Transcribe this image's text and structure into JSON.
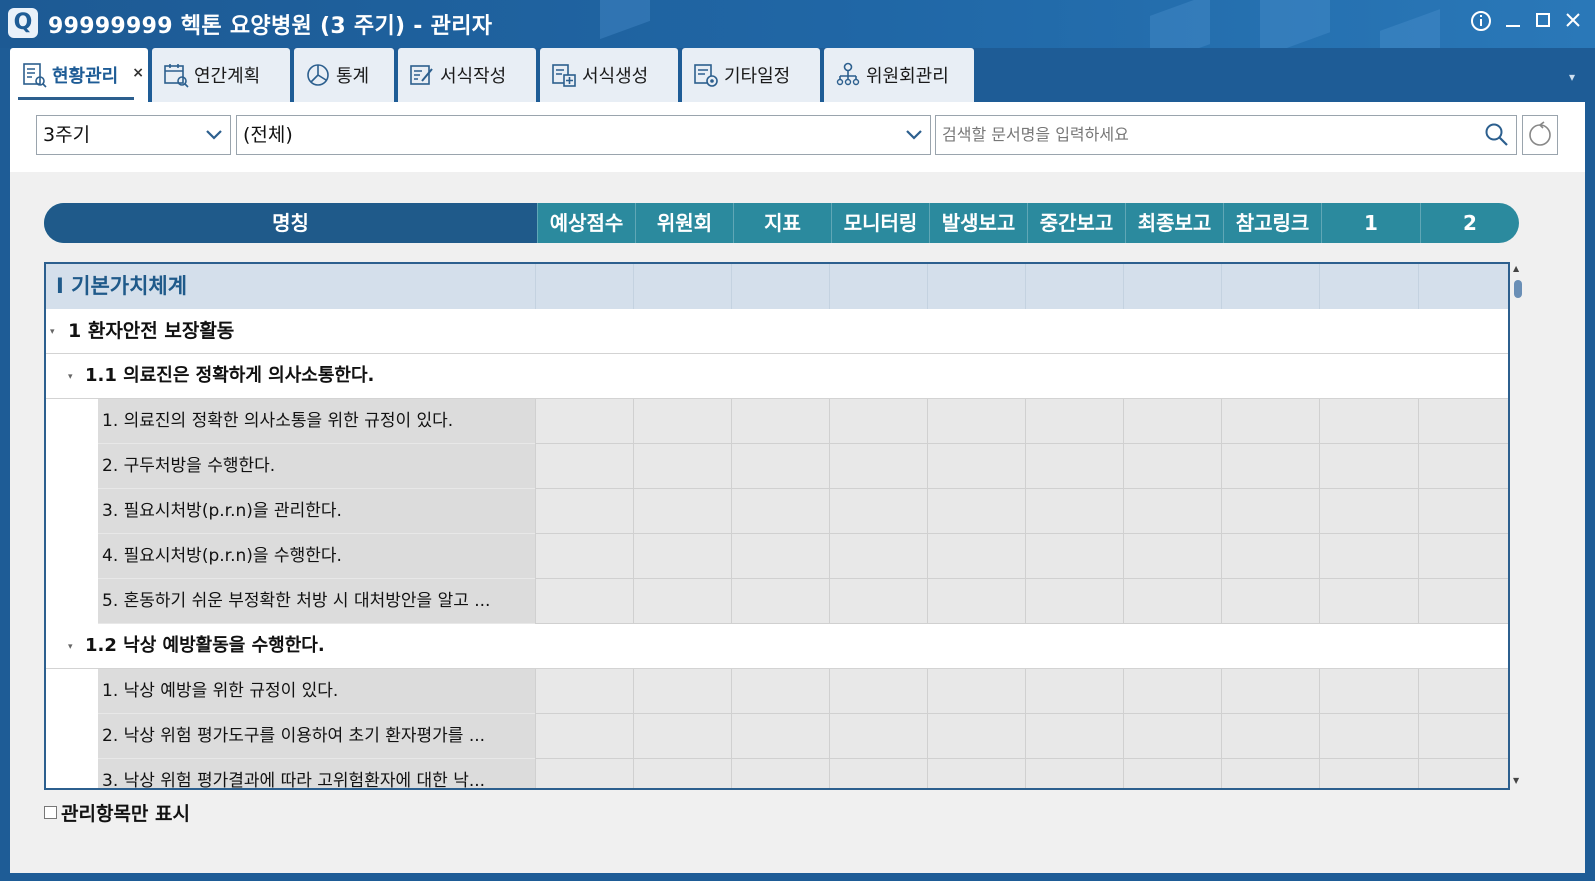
{
  "window": {
    "title": "99999999  헥톤 요양병원 (3 주기) - 관리자",
    "logo": "Q"
  },
  "tabs": [
    {
      "label": "현황관리",
      "icon": "checklist-search-icon",
      "active": true
    },
    {
      "label": "연간계획",
      "icon": "calendar-search-icon"
    },
    {
      "label": "통계",
      "icon": "pie-chart-icon"
    },
    {
      "label": "서식작성",
      "icon": "form-edit-icon"
    },
    {
      "label": "서식생성",
      "icon": "form-add-icon"
    },
    {
      "label": "기타일정",
      "icon": "schedule-gear-icon"
    },
    {
      "label": "위원회관리",
      "icon": "org-chart-icon"
    }
  ],
  "filters": {
    "cycle": "3주기",
    "category": "(전체)",
    "search_placeholder": "검색할 문서명을 입력하세요"
  },
  "columns": {
    "name": "명칭",
    "others": [
      "예상점수",
      "위원회",
      "지표",
      "모니터링",
      "발생보고",
      "중간보고",
      "최종보고",
      "참고링크",
      "1",
      "2"
    ]
  },
  "rows": [
    {
      "type": "section",
      "label": "Ⅰ 기본가치체계"
    },
    {
      "type": "group",
      "level": 1,
      "label": "1 환자안전 보장활동"
    },
    {
      "type": "group",
      "level": 2,
      "label": "1.1 의료진은 정확하게 의사소통한다."
    },
    {
      "type": "item",
      "label": "1. 의료진의 정확한 의사소통을 위한 규정이 있다."
    },
    {
      "type": "item",
      "label": "2. 구두처방을 수행한다."
    },
    {
      "type": "item",
      "label": "3. 필요시처방(p.r.n)을 관리한다."
    },
    {
      "type": "item",
      "label": "4. 필요시처방(p.r.n)을 수행한다."
    },
    {
      "type": "item",
      "label": "5. 혼동하기 쉬운 부정확한 처방 시 대처방안을 알고 ..."
    },
    {
      "type": "group",
      "level": 2,
      "label": "1.2 낙상 예방활동을 수행한다."
    },
    {
      "type": "item",
      "label": "1. 낙상 예방을 위한 규정이 있다."
    },
    {
      "type": "item",
      "label": "2. 낙상 위험 평가도구를 이용하여 초기 환자평가를 ..."
    },
    {
      "type": "item",
      "label": "3. 낙상 위험 평가결과에 따라 고위험환자에 대한 낙..."
    }
  ],
  "footer": {
    "checkbox_label": "관리항목만 표시",
    "checked": false
  },
  "colors": {
    "title_bg": "#1e5c96",
    "header_name_bg": "#1f5a8a",
    "header_cols_bg": "#2b8a9e",
    "section_bg": "#d4dfeb"
  }
}
